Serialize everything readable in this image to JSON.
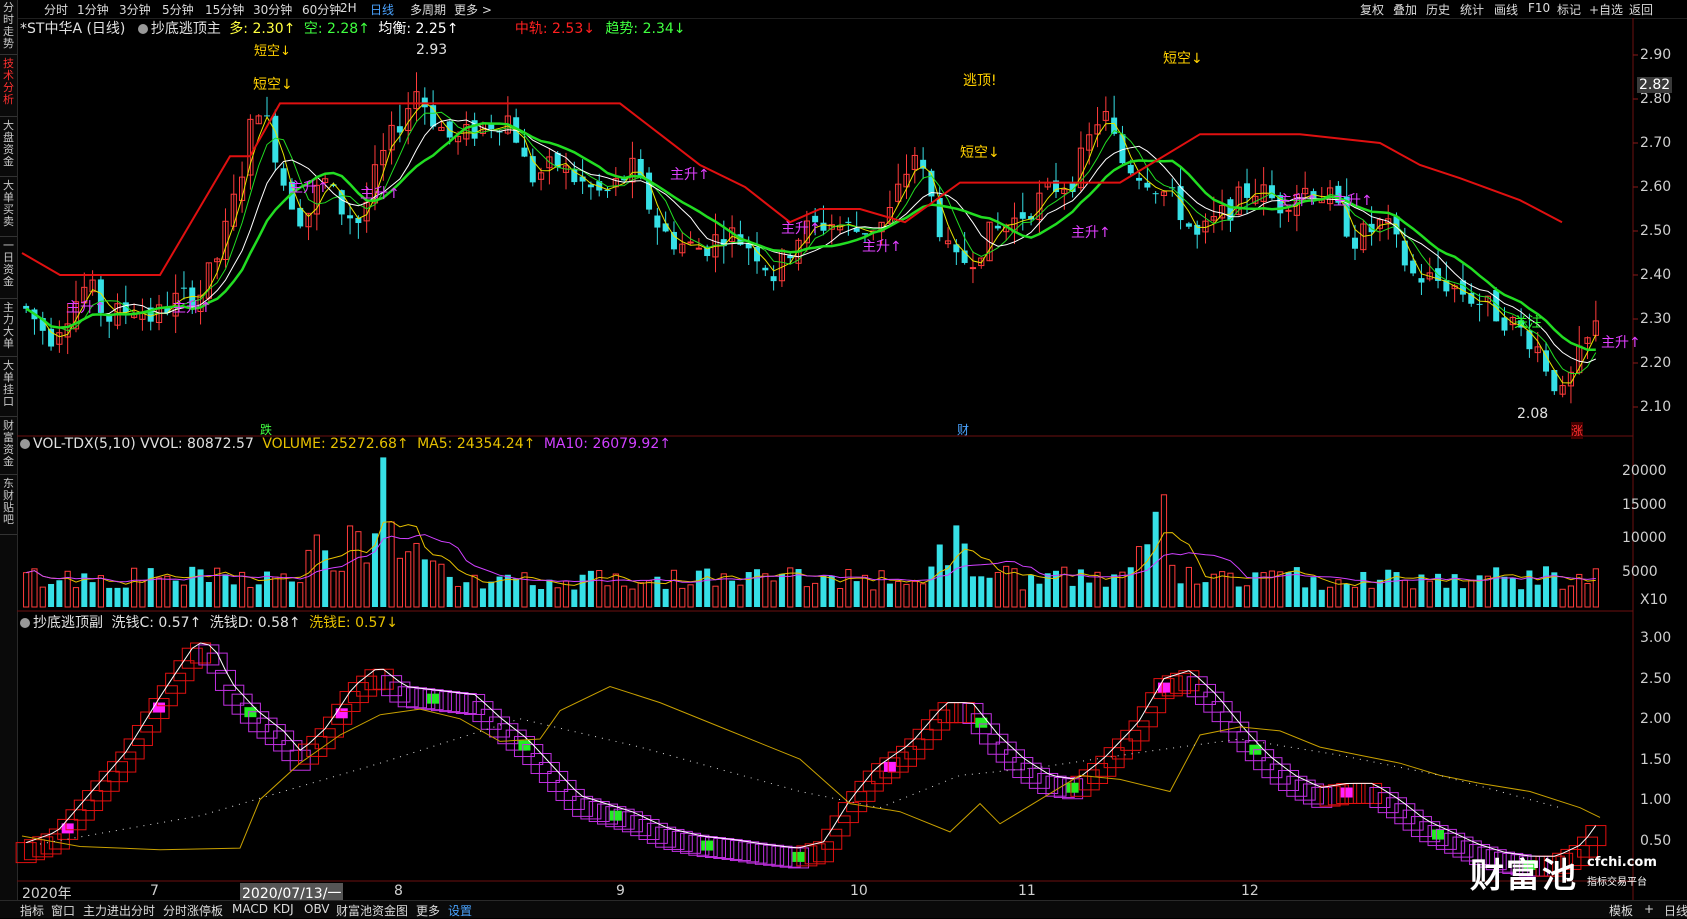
{
  "left_tabs": [
    "分时走势",
    "技术分析",
    "大盘资金",
    "大单买卖",
    "一日资金",
    "主力大单",
    "大单挂口",
    "财富资金",
    "东财贴吧"
  ],
  "left_active": 1,
  "top_tabs": [
    "分时",
    "1分钟",
    "3分钟",
    "5分钟",
    "15分钟",
    "30分钟",
    "60分钟",
    "2H",
    "日线",
    "多周期",
    "更多"
  ],
  "top_active": 8,
  "top_right": [
    "复权",
    "叠加",
    "历史",
    "统计",
    "画线",
    "F10",
    "标记",
    "+自选",
    "返回"
  ],
  "main_info": {
    "title": "*ST中华A (日线)",
    "indicator": "抄底逃顶主",
    "duo": "多: 2.30↑",
    "kong": "空: 2.28↑",
    "junheng": "均衡: 2.25↑",
    "zhongui": "中轨: 2.53↓",
    "qushi": "趋势: 2.34↓"
  },
  "price_axis": [
    "2.90",
    "2.80",
    "2.70",
    "2.60",
    "2.50",
    "2.40",
    "2.30",
    "2.20",
    "2.10"
  ],
  "price_current": "2.82",
  "price_high_label": "2.93",
  "price_low_label": "2.08",
  "signals": {
    "short1": "短空↓",
    "short1_top": "短空↓",
    "short2": "短空↓",
    "short3": "短空↓",
    "escape": "逃顶!",
    "up_labels": [
      "主升↑",
      "主升↑",
      "主升↑",
      "主升↑",
      "主升↑",
      "主升↑",
      "主升↑",
      "主升↑",
      "主升↑"
    ],
    "watch": "关注",
    "die": "跌",
    "cai": "财",
    "zhang": "涨"
  },
  "vol_info": {
    "name": "VOL-TDX(5,10)",
    "vvol": "VVOL: 80872.57",
    "volume": "VOLUME: 25272.68↑",
    "ma5": "MA5: 24354.24↑",
    "ma10": "MA10: 26079.92↑"
  },
  "vol_axis": [
    "20000",
    "15000",
    "10000",
    "5000",
    "X10"
  ],
  "sub_info": {
    "name": "抄底逃顶副",
    "c": "洗钱C: 0.57↑",
    "d": "洗钱D: 0.58↑",
    "e": "洗钱E: 0.57↓"
  },
  "sub_axis": [
    "3.00",
    "2.50",
    "2.00",
    "1.50",
    "1.00",
    "0.50"
  ],
  "x_axis": [
    "2020年",
    "7",
    "2020/07/13/一",
    "8",
    "9",
    "10",
    "11",
    "12"
  ],
  "bottom_tabs": [
    "指标",
    "窗口",
    "主力进出分时",
    "分时涨停板",
    "MACD",
    "KDJ",
    "OBV",
    "财富池资金图",
    "更多",
    "设置"
  ],
  "bottom_active": 9,
  "bottom_right": [
    "模板",
    "+",
    "日线"
  ],
  "watermark_main": "财富池",
  "watermark_url": "cfchi.com",
  "watermark_sub": "指标交易平台",
  "colors": {
    "up": "#ff3b3b",
    "down": "#36e0e6",
    "green": "#22dd22",
    "red": "#e01010",
    "white": "#ffffff",
    "yellow": "#e6e600",
    "magenta": "#e040ff",
    "gold": "#d8a000"
  }
}
